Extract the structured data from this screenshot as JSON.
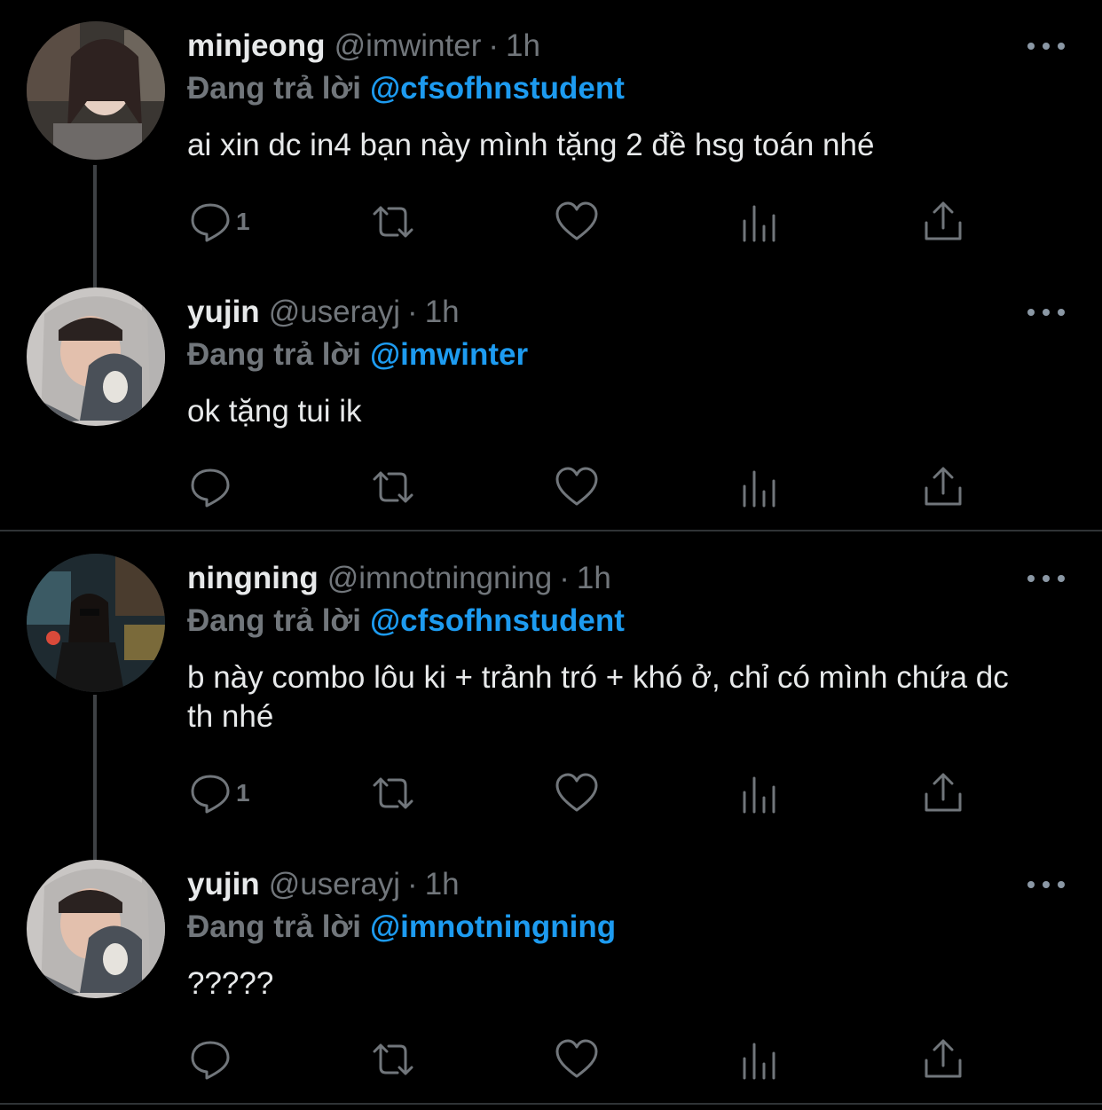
{
  "reply_prefix": "Đang trả lời",
  "separator_dot": "·",
  "tweets": [
    {
      "name": "minjeong",
      "handle": "@imwinter",
      "time": "1h",
      "reply_to": "@cfsofhnstudent",
      "text": "ai xin dc in4 bạn này mình tặng 2 đề hsg toán nhé",
      "reply_count": "1"
    },
    {
      "name": "yujin",
      "handle": "@userayj",
      "time": "1h",
      "reply_to": "@imwinter",
      "text": "ok tặng tui ik",
      "reply_count": ""
    },
    {
      "name": "ningning",
      "handle": "@imnotningning",
      "time": "1h",
      "reply_to": "@cfsofhnstudent",
      "text": "b này combo lôu ki + trảnh tró + khó ở, chỉ có mình chứa dc th nhé",
      "reply_count": "1"
    },
    {
      "name": "yujin",
      "handle": "@userayj",
      "time": "1h",
      "reply_to": "@imnotningning",
      "text": "?????",
      "reply_count": ""
    }
  ],
  "icons": [
    "reply-icon",
    "retweet-icon",
    "like-icon",
    "analytics-icon",
    "share-icon",
    "more-icon"
  ],
  "colors": {
    "background": "#000000",
    "text": "#e7e9ea",
    "secondary": "#71767b",
    "link": "#1d9bf0"
  }
}
